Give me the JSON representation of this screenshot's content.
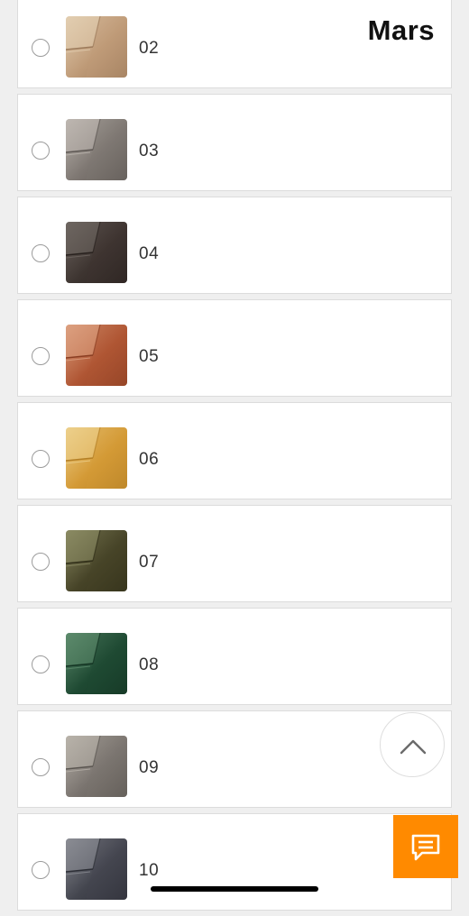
{
  "header": {
    "title": "Mars"
  },
  "colors": {
    "accent": "#ff8a00",
    "radio_border": "#9b9b9b"
  },
  "options": [
    {
      "code": "02",
      "swatch": {
        "base": "#bf9b78",
        "light": "#e2cdb0",
        "dark": "#9c7a5a"
      }
    },
    {
      "code": "03",
      "swatch": {
        "base": "#7f7873",
        "light": "#bdb7b0",
        "dark": "#5d5753"
      }
    },
    {
      "code": "04",
      "swatch": {
        "base": "#3e3531",
        "light": "#6e6661",
        "dark": "#28211e"
      }
    },
    {
      "code": "05",
      "swatch": {
        "base": "#b05634",
        "light": "#dca080",
        "dark": "#8a3e22"
      }
    },
    {
      "code": "06",
      "swatch": {
        "base": "#d49a36",
        "light": "#eccf8b",
        "dark": "#b47f25"
      }
    },
    {
      "code": "07",
      "swatch": {
        "base": "#474428",
        "light": "#8a8a63",
        "dark": "#302e18"
      }
    },
    {
      "code": "08",
      "swatch": {
        "base": "#1f4a33",
        "light": "#5c8a6c",
        "dark": "#133322"
      }
    },
    {
      "code": "09",
      "swatch": {
        "base": "#7b7570",
        "light": "#b8b2aa",
        "dark": "#5b5651"
      }
    },
    {
      "code": "10",
      "swatch": {
        "base": "#44464f",
        "light": "#8a8c93",
        "dark": "#2d2f36"
      }
    }
  ],
  "icons": {
    "scroll_top": "chevron-up-icon",
    "chat": "chat-icon"
  }
}
